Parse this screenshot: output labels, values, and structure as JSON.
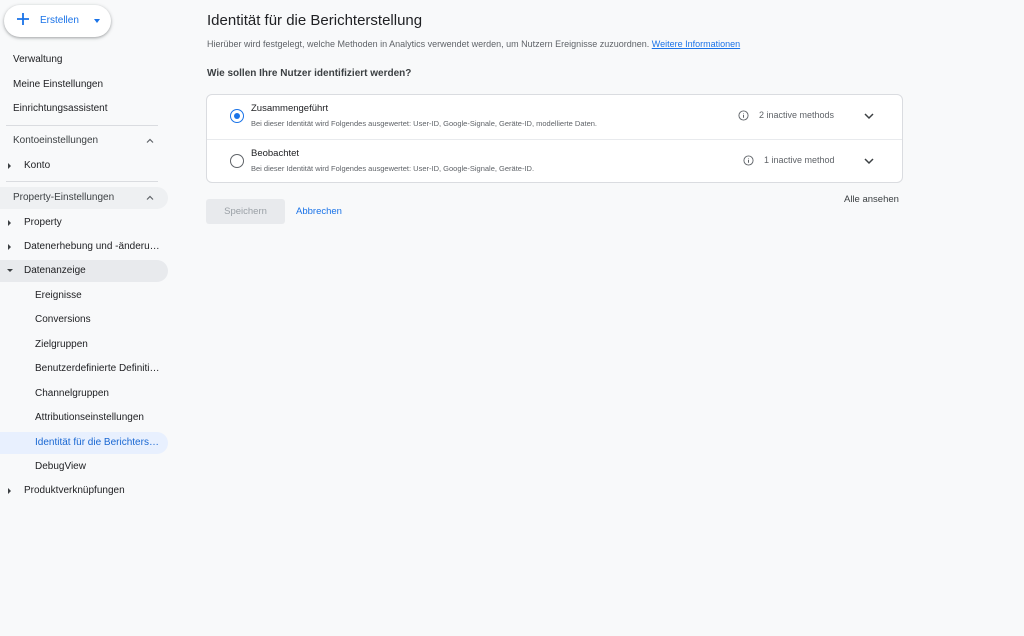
{
  "create_button": {
    "label": "Erstellen"
  },
  "sidebar": {
    "top_items": [
      "Verwaltung",
      "Meine Einstellungen",
      "Einrichtungsassistent"
    ],
    "account_section": {
      "title": "Kontoeinstellungen",
      "items": [
        "Konto"
      ]
    },
    "property_section": {
      "title": "Property-Einstellungen",
      "items": [
        "Property",
        "Datenerhebung und -änderu…",
        "Datenanzeige"
      ],
      "datenanzeige_children": [
        "Ereignisse",
        "Conversions",
        "Zielgruppen",
        "Benutzerdefinierte Definiti…",
        "Channelgruppen",
        "Attributionseinstellungen",
        "Identität für die Berichters…",
        "DebugView"
      ],
      "last_item": "Produktverknüpfungen"
    }
  },
  "main": {
    "title": "Identität für die Berichterstellung",
    "description": "Hierüber wird festgelegt, welche Methoden in Analytics verwendet werden, um Nutzern Ereignisse zuzuordnen.",
    "learn_more": "Weitere Informationen",
    "question": "Wie sollen Ihre Nutzer identifiziert werden?",
    "options": [
      {
        "title": "Zusammengeführt",
        "description": "Bei dieser Identität wird Folgendes ausgewertet: User-ID, Google-Signale, Geräte-ID, modellierte Daten.",
        "status": "2 inactive methods",
        "selected": true
      },
      {
        "title": "Beobachtet",
        "description": "Bei dieser Identität wird Folgendes ausgewertet: User-ID, Google-Signale, Geräte-ID.",
        "status": "1 inactive method",
        "selected": false
      }
    ],
    "view_all": "Alle ansehen",
    "save_label": "Speichern",
    "cancel_label": "Abbrechen"
  },
  "colors": {
    "accent": "#1a73e8",
    "background": "#f8f9fa",
    "active_bg": "#e8f0fe"
  }
}
